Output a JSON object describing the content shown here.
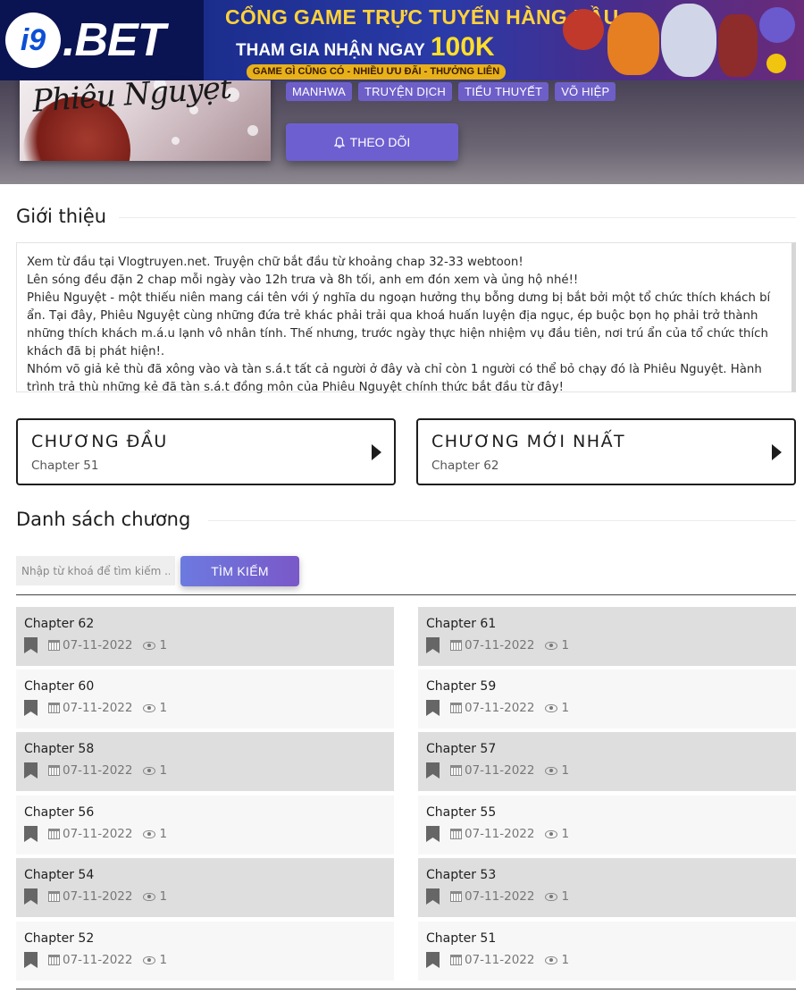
{
  "ad_banner": {
    "logo_text_i9": "i9",
    "logo_text_bet": ".BET",
    "headline": "CỔNG GAME TRỰC TUYẾN HÀNG ĐẦU",
    "promo_text": "THAM GIA NHẬN NGAY",
    "promo_amount": "100K",
    "tagline": "GAME GÌ CŨNG CÓ - NHIỀU ƯU ĐÃI - THƯỞNG LIÊN TỤC"
  },
  "cover": {
    "title_art": "Phiêu Nguyệt"
  },
  "tags": [
    "MANHWA",
    "TRUYỆN DỊCH",
    "TIỂU THUYẾT",
    "VÕ HIỆP"
  ],
  "follow_button": {
    "label": "THEO DÕI",
    "icon": "bell-icon"
  },
  "intro": {
    "heading": "Giới thiệu",
    "lines": [
      "Xem từ đầu tại Vlogtruyen.net. Truyện chữ bắt đầu từ khoảng chap 32-33 webtoon!",
      "Lên sóng đều đặn 2 chap mỗi ngày vào 12h trưa và 8h tối, anh em đón xem và ủng hộ nhé!!",
      "Phiêu Nguyệt - một thiếu niên mang cái tên với ý nghĩa du ngoạn hưởng thụ bỗng dưng bị bắt bởi một tổ chức thích khách bí ẩn. Tại đây, Phiêu Nguyệt cùng những đứa trẻ khác phải trải qua khoá huấn luyện địa ngục, ép buộc bọn họ phải trở thành những thích khách m.á.u lạnh vô nhân tính. Thế nhưng, trước ngày thực hiện nhiệm vụ đầu tiên, nơi trú ẩn của tổ chức thích khách đã bị phát hiện!.",
      "Nhóm võ giả kẻ thù đã xông vào và tàn s.á.t tất cả người ở đây và chỉ còn 1 người có thể bỏ chạy đó là Phiêu Nguyệt. Hành trình trả thù những kẻ đã tàn s.á.t đồng môn của Phiêu Nguyệt chính thức bắt đầu từ đây!"
    ]
  },
  "first_chapter": {
    "label": "CHƯƠNG ĐẦU",
    "chapter": "Chapter 51"
  },
  "latest_chapter": {
    "label": "CHƯƠNG MỚI NHẤT",
    "chapter": "Chapter 62"
  },
  "chapter_list": {
    "heading": "Danh sách chương",
    "search_placeholder": "Nhập từ khoá để tìm kiếm ...",
    "search_button": "TÌM KIẾM",
    "items": [
      {
        "name": "Chapter 62",
        "date": "07-11-2022",
        "views": "1"
      },
      {
        "name": "Chapter 61",
        "date": "07-11-2022",
        "views": "1"
      },
      {
        "name": "Chapter 60",
        "date": "07-11-2022",
        "views": "1"
      },
      {
        "name": "Chapter 59",
        "date": "07-11-2022",
        "views": "1"
      },
      {
        "name": "Chapter 58",
        "date": "07-11-2022",
        "views": "1"
      },
      {
        "name": "Chapter 57",
        "date": "07-11-2022",
        "views": "1"
      },
      {
        "name": "Chapter 56",
        "date": "07-11-2022",
        "views": "1"
      },
      {
        "name": "Chapter 55",
        "date": "07-11-2022",
        "views": "1"
      },
      {
        "name": "Chapter 54",
        "date": "07-11-2022",
        "views": "1"
      },
      {
        "name": "Chapter 53",
        "date": "07-11-2022",
        "views": "1"
      },
      {
        "name": "Chapter 52",
        "date": "07-11-2022",
        "views": "1"
      },
      {
        "name": "Chapter 51",
        "date": "07-11-2022",
        "views": "1"
      }
    ]
  },
  "colors": {
    "accent": "#6e5fc8",
    "row_dark": "#dedede",
    "row_light": "#f7f7f7"
  }
}
